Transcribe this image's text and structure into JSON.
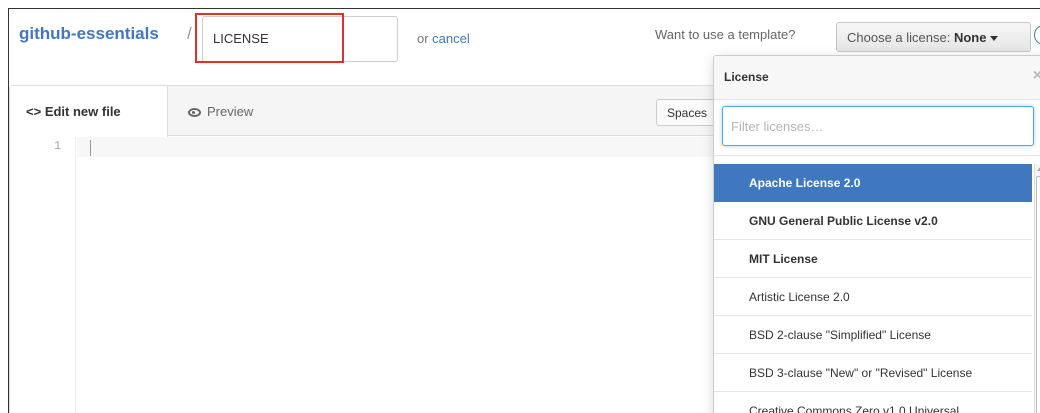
{
  "header": {
    "repo_name": "github-essentials",
    "path_separator": "/",
    "filename_value": "LICENSE",
    "or_text": "or ",
    "cancel_label": "cancel",
    "template_question": "Want to use a template?",
    "license_button_prefix": "Choose a license: ",
    "license_button_value": "None"
  },
  "editor": {
    "tabs": [
      {
        "label": "Edit new file",
        "icon": "code-icon",
        "active": true
      },
      {
        "label": "Preview",
        "icon": "eye-icon",
        "active": false
      }
    ],
    "indent_label": "Spaces",
    "line_numbers": [
      "1"
    ]
  },
  "license_dropdown": {
    "title": "License",
    "close_glyph": "×",
    "filter_placeholder": "Filter licenses…",
    "items": [
      {
        "label": "Apache License 2.0",
        "selected": true,
        "bold": true
      },
      {
        "label": "GNU General Public License v2.0",
        "selected": false,
        "bold": true
      },
      {
        "label": "MIT License",
        "selected": false,
        "bold": true
      },
      {
        "label": "Artistic License 2.0",
        "selected": false,
        "bold": false
      },
      {
        "label": "BSD 2-clause \"Simplified\" License",
        "selected": false,
        "bold": false
      },
      {
        "label": "BSD 3-clause \"New\" or \"Revised\" License",
        "selected": false,
        "bold": false
      },
      {
        "label": "Creative Commons Zero v1.0 Universal",
        "selected": false,
        "bold": false
      }
    ]
  },
  "colors": {
    "link": "#4078c0",
    "selected_bg": "#4078c0",
    "highlight_annotation": "#e0302a"
  }
}
